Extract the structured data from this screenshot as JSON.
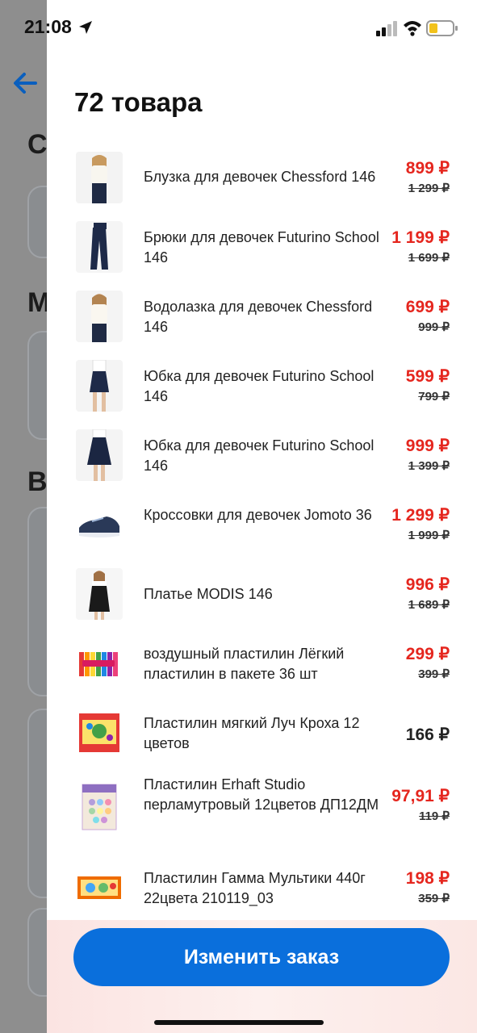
{
  "status": {
    "time": "21:08"
  },
  "background": {
    "letters": [
      "С",
      "М",
      "В"
    ]
  },
  "sheet": {
    "title": "72 товара",
    "items": [
      {
        "name": "Блузка для девочек Chessford 146",
        "price": "899 ₽",
        "old_price": "1 299 ₽",
        "image": "blouse"
      },
      {
        "name": "Брюки для девочек Futurino School 146",
        "price": "1 199 ₽",
        "old_price": "1 699 ₽",
        "image": "trousers"
      },
      {
        "name": "Водолазка для девочек Chessford 146",
        "price": "699 ₽",
        "old_price": "999 ₽",
        "image": "turtleneck"
      },
      {
        "name": "Юбка для девочек Futurino School 146",
        "price": "599 ₽",
        "old_price": "799 ₽",
        "image": "skirt"
      },
      {
        "name": "Юбка для девочек Futurino School 146",
        "price": "999 ₽",
        "old_price": "1 399 ₽",
        "image": "skirt-long"
      },
      {
        "name": "Кроссовки для девочек Jomoto 36",
        "price": "1 299 ₽",
        "old_price": "1 999 ₽",
        "image": "sneaker"
      },
      {
        "name": "Платье MODIS 146",
        "price": "996 ₽",
        "old_price": "1 689 ₽",
        "image": "dress"
      },
      {
        "name": "воздушный пластилин Лёгкий пластилин в пакете 36 шт",
        "price": "299 ₽",
        "old_price": "399 ₽",
        "image": "clay-sticks"
      },
      {
        "name": "Пластилин мягкий Луч Кроха 12 цветов",
        "price": "166 ₽",
        "old_price": "",
        "image": "clay-box"
      },
      {
        "name": "Пластилин Erhaft Studio перламутровый 12цветов ДП12ДМ",
        "price": "97,91 ₽",
        "old_price": "119 ₽",
        "image": "clay-pearl"
      },
      {
        "name": "Пластилин Гамма Мультики 440г 22цвета 210119_03",
        "price": "198 ₽",
        "old_price": "359 ₽",
        "image": "clay-gamma"
      }
    ],
    "button_label": "Изменить заказ"
  },
  "colors": {
    "accent": "#0a6fdc",
    "sale": "#e5261e"
  }
}
